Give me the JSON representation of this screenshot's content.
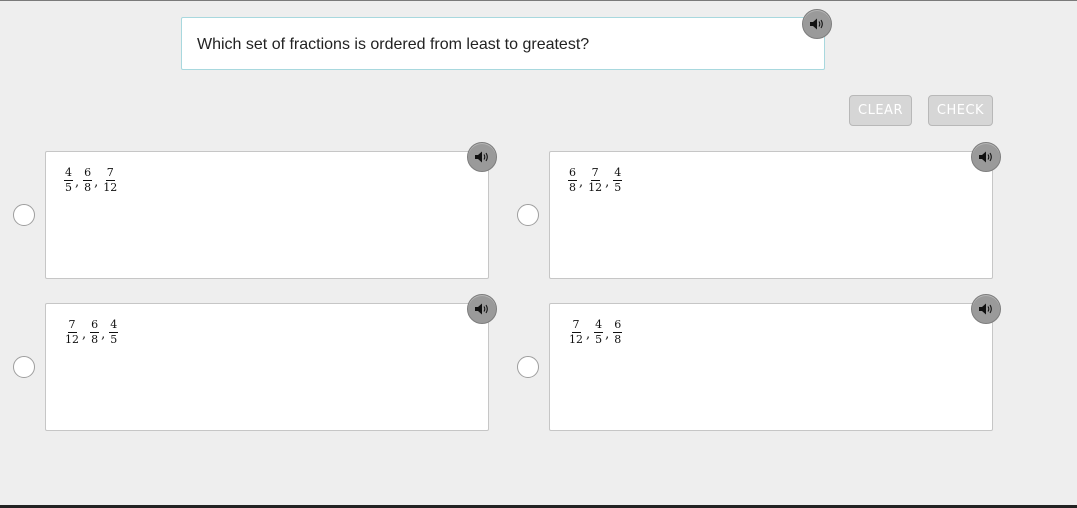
{
  "question": {
    "text": "Which set of fractions is ordered from least to greatest?",
    "audio_icon": "speaker-icon"
  },
  "buttons": {
    "clear_label": "CLEAR",
    "check_label": "CHECK"
  },
  "options": [
    {
      "fractions": [
        {
          "num": "4",
          "den": "5"
        },
        {
          "num": "6",
          "den": "8"
        },
        {
          "num": "7",
          "den": "12"
        }
      ],
      "separators": [
        ",",
        ","
      ]
    },
    {
      "fractions": [
        {
          "num": "6",
          "den": "8"
        },
        {
          "num": "7",
          "den": "12"
        },
        {
          "num": "4",
          "den": "5"
        }
      ],
      "separators": [
        ",",
        ","
      ]
    },
    {
      "fractions": [
        {
          "num": "7",
          "den": "12"
        },
        {
          "num": "6",
          "den": "8"
        },
        {
          "num": "4",
          "den": "5"
        }
      ],
      "separators": [
        ",",
        ","
      ]
    },
    {
      "fractions": [
        {
          "num": "7",
          "den": "12"
        },
        {
          "num": "4",
          "den": "5"
        },
        {
          "num": "6",
          "den": "8"
        }
      ],
      "separators": [
        ",",
        ","
      ]
    }
  ],
  "colors": {
    "background": "#eeeeee",
    "question_border": "#a8d8de",
    "speaker": "#9a9a9a",
    "button_disabled": "#d6d6d6"
  }
}
